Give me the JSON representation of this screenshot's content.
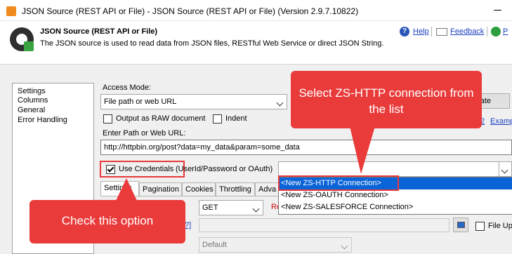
{
  "window": {
    "title": "JSON Source (REST API or File) - JSON Source (REST API or File) (Version 2.9.7.10822)"
  },
  "header": {
    "title": "JSON Source (REST API or File)",
    "description": "The JSON source is used to read data from JSON files, RESTful Web Service or direct JSON String.",
    "help": "Help",
    "feedback": "Feedback",
    "extra": "P"
  },
  "sidebar": {
    "items": [
      "Settings",
      "Columns",
      "General",
      "Error Handling"
    ]
  },
  "main": {
    "access_mode_label": "Access Mode:",
    "access_mode_value": "File path or web URL",
    "template_button": "nplate",
    "output_raw_label": "Output as RAW document",
    "indent_label": "Indent",
    "examples_link": "Examp",
    "examples_num": "2",
    "path_label": "Enter Path or Web URL:",
    "path_value": "http://httpbin.org/post?data=my_data&param=some_data",
    "use_credentials_label": "Use Credentials",
    "use_credentials_hint": "(UserId/Password or OAuth)",
    "connection_value": "",
    "tabs": [
      "Settings",
      "Pagination",
      "Cookies",
      "Throttling",
      "Adva"
    ],
    "method_value": "GET",
    "method_side_label": "Re",
    "help_fragment": "?]",
    "file_upload_label": "File Upl",
    "default_value": "Default"
  },
  "dropdown": {
    "options": [
      "<New ZS-HTTP Connection>",
      "<New ZS-OAUTH Connection>",
      "<New ZS-SALESFORCE Connection>"
    ],
    "selected_index": 0
  },
  "annotations": {
    "select_callout": "Select ZS-HTTP connection from the list",
    "check_callout": "Check this option",
    "color": "#ea3b3b"
  }
}
